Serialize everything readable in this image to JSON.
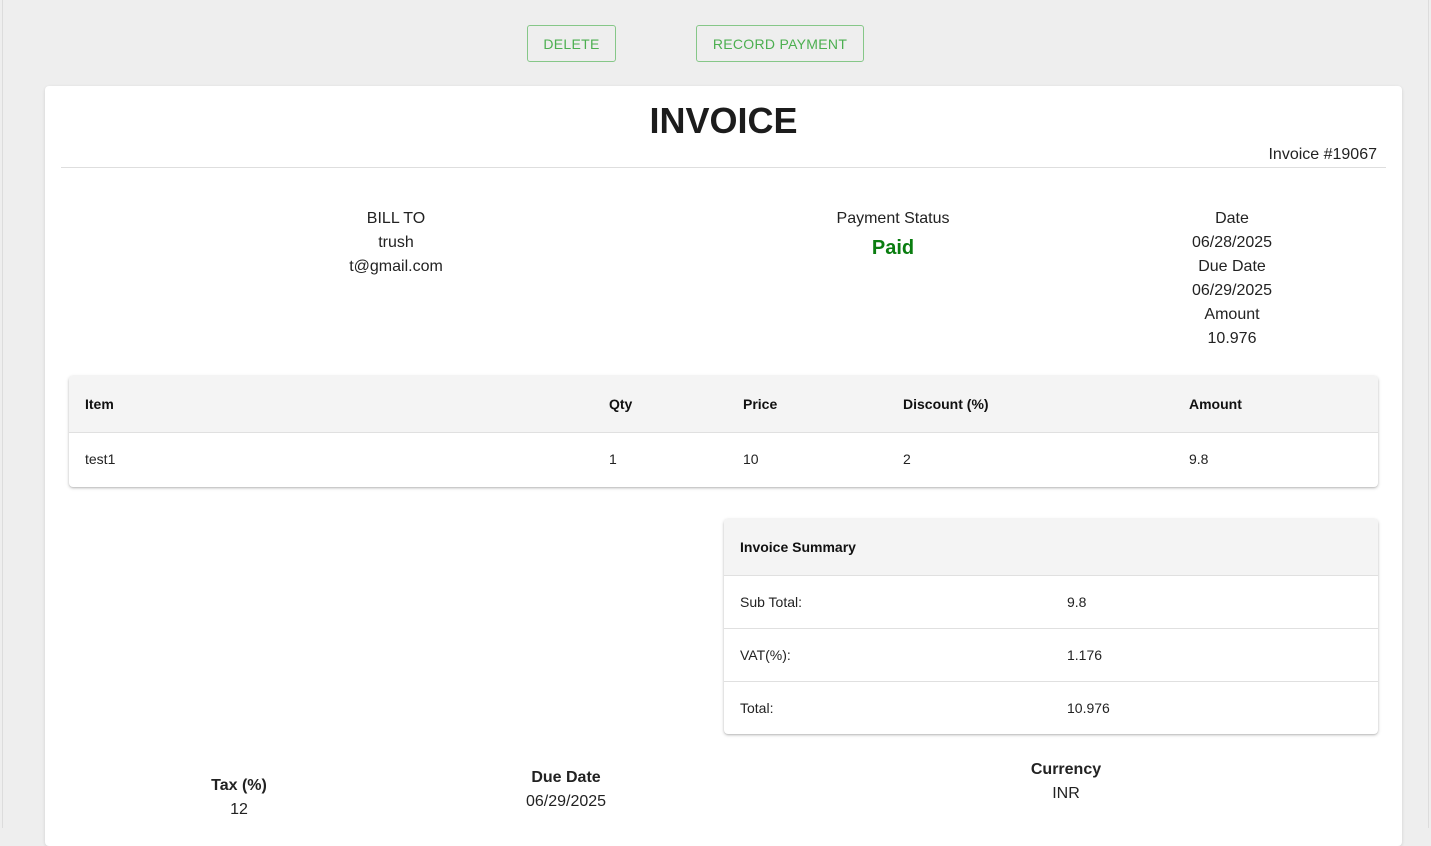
{
  "toolbar": {
    "delete_label": "DELETE",
    "record_payment_label": "RECORD PAYMENT",
    "accent_color": "#4caf50"
  },
  "invoice": {
    "title": "INVOICE",
    "number": "Invoice #19067",
    "bill_to": {
      "heading": "BILL TO",
      "name": "trush",
      "email": "t@gmail.com"
    },
    "payment_status": {
      "heading": "Payment Status",
      "value": "Paid",
      "color": "#0a7d10"
    },
    "dates": {
      "date_label": "Date",
      "date_value": "06/28/2025",
      "due_label": "Due Date",
      "due_value": "06/29/2025",
      "amount_label": "Amount",
      "amount_value": "10.976"
    }
  },
  "items_table": {
    "headers": [
      "Item",
      "Qty",
      "Price",
      "Discount (%)",
      "Amount"
    ],
    "rows": [
      [
        "test1",
        "1",
        "10",
        "2",
        "9.8"
      ]
    ]
  },
  "summary": {
    "heading": "Invoice Summary",
    "rows": [
      {
        "label": "Sub Total:",
        "value": "9.8"
      },
      {
        "label": "VAT(%):",
        "value": "1.176"
      },
      {
        "label": "Total:",
        "value": "10.976"
      }
    ]
  },
  "footer": {
    "tax_label": "Tax (%)",
    "tax_value": "12",
    "due_label": "Due Date",
    "due_value": "06/29/2025",
    "currency_label": "Currency",
    "currency_value": "INR"
  }
}
